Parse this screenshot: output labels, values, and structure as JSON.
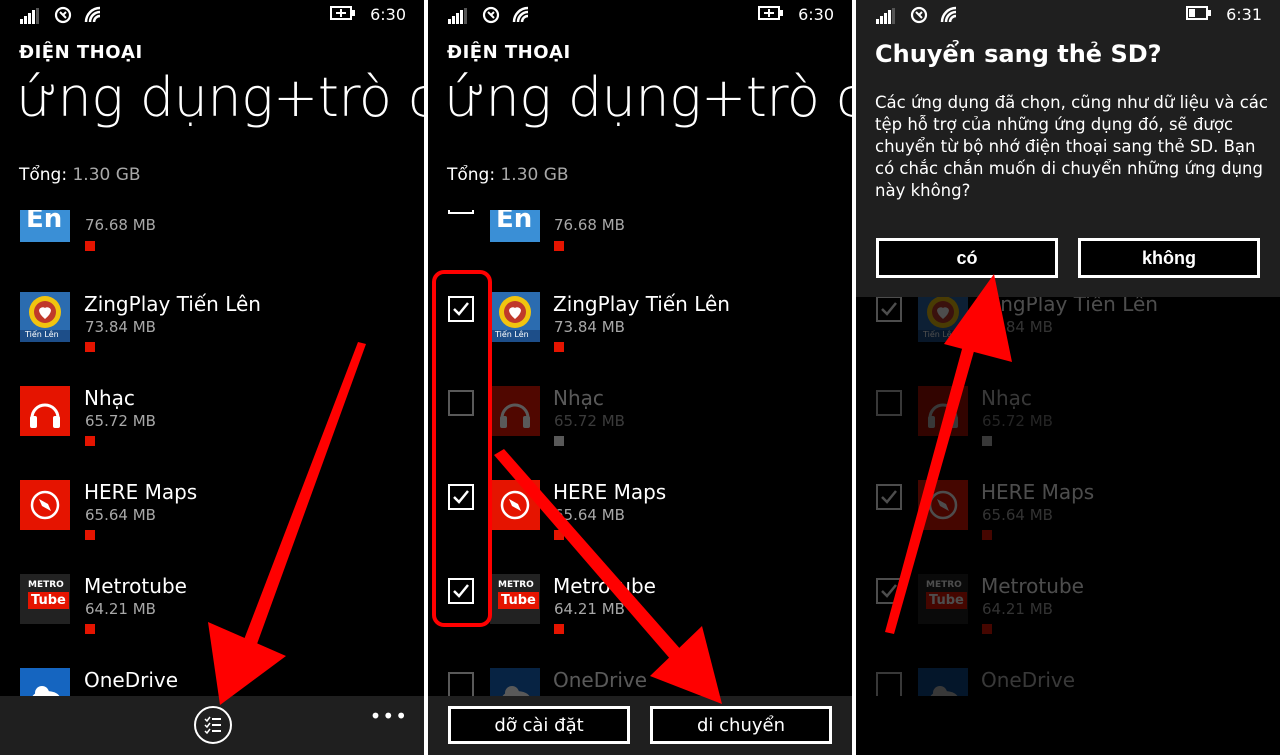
{
  "status": {
    "time1": "6:30",
    "time2": "6:30",
    "time3": "6:31"
  },
  "screen": {
    "header": "ĐIỆN THOẠI",
    "title": "ứng dụng+trò c",
    "total_label": "Tổng:",
    "total_value": "1.30 GB"
  },
  "apps": [
    {
      "name": "",
      "size": "76.68 MB",
      "tile_text": "En",
      "checked": false,
      "bar": "#e51400"
    },
    {
      "name": "ZingPlay Tiến Lên",
      "size": "73.84 MB",
      "tile_text": "Tiến Lên",
      "checked": true,
      "bar": "#e51400"
    },
    {
      "name": "Nhạc",
      "size": "65.72 MB",
      "tile_text": "",
      "checked": false,
      "bar": "#e51400"
    },
    {
      "name": "HERE Maps",
      "size": "65.64 MB",
      "tile_text": "",
      "checked": true,
      "bar": "#e51400"
    },
    {
      "name": "Metrotube",
      "size": "64.21 MB",
      "tile_text": "METRO",
      "tile_text2": "Tube",
      "checked": true,
      "bar": "#e51400"
    },
    {
      "name": "OneDrive",
      "size": "",
      "tile_text": "",
      "checked": false,
      "bar": "#e51400"
    }
  ],
  "appbar2": {
    "uninstall": "dỡ cài đặt",
    "move": "di chuyển"
  },
  "dialog": {
    "title": "Chuyển sang thẻ SD?",
    "body": "Các ứng dụng đã chọn, cũng như dữ liệu và các tệp hỗ trợ của những ứng dụng đó, sẽ được chuyển từ bộ nhớ điện thoại sang thẻ SD. Bạn có chắc chắn muốn di chuyển những ứng dụng này không?",
    "yes": "có",
    "no": "không"
  },
  "colors": {
    "accent": "#e51400",
    "background": "#000000",
    "appbar": "#1f1f1f",
    "arrow": "#ff0000"
  },
  "icons": [
    "signal-icon",
    "nfc-icon",
    "wifi-icon",
    "battery-charging-icon",
    "battery-icon",
    "select-list-icon",
    "more-icon",
    "checkbox-icon"
  ]
}
